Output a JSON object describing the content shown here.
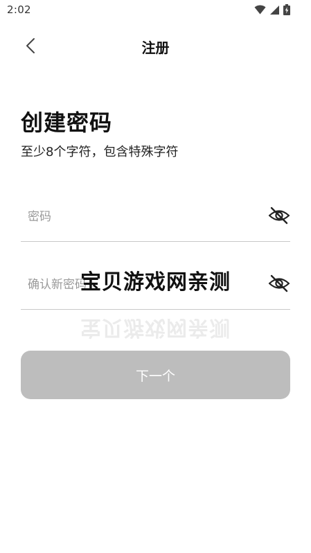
{
  "status_bar": {
    "time": "2:02",
    "icons": [
      "wifi-icon",
      "signal-icon",
      "battery-icon"
    ]
  },
  "app_bar": {
    "back_icon": "chevron-left-icon",
    "title": "注册"
  },
  "content": {
    "heading": "创建密码",
    "subheading": "至少8个字符，包含特殊字符"
  },
  "fields": {
    "password": {
      "placeholder": "密码",
      "value": "",
      "visibility_icon": "eye-off-icon"
    },
    "confirm_password": {
      "placeholder": "确认新密码",
      "value": "",
      "visibility_icon": "eye-off-icon"
    }
  },
  "next_button": {
    "label": "下一个",
    "state": "disabled"
  },
  "watermark": {
    "text": "宝贝游戏网亲测"
  },
  "colors": {
    "button_disabled_bg": "#bdbdbd",
    "button_text": "#ffffff",
    "divider": "#c8c8c8",
    "placeholder": "#9a9a9a"
  }
}
